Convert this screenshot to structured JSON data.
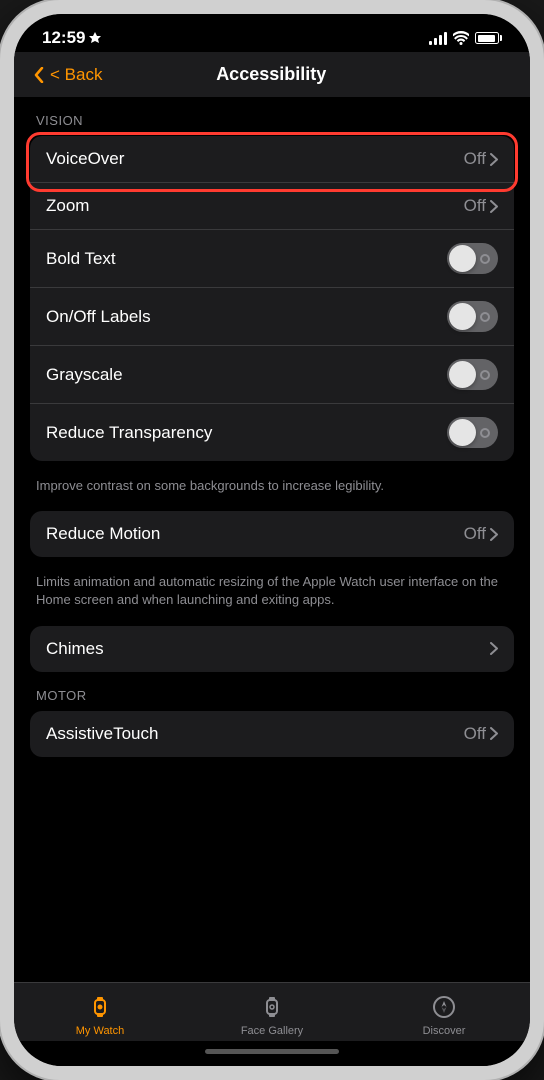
{
  "status": {
    "time": "12:59",
    "location_arrow": "▶",
    "signal_label": "signal",
    "wifi_label": "wifi",
    "battery_label": "battery"
  },
  "nav": {
    "back_label": "< Back",
    "title": "Accessibility"
  },
  "sections": [
    {
      "label": "VISION",
      "rows": [
        {
          "id": "voiceover",
          "label": "VoiceOver",
          "value": "Off",
          "type": "navigate",
          "highlighted": true
        },
        {
          "id": "zoom",
          "label": "Zoom",
          "value": "Off",
          "type": "navigate"
        },
        {
          "id": "bold-text",
          "label": "Bold Text",
          "value": "",
          "type": "toggle"
        },
        {
          "id": "onoff-labels",
          "label": "On/Off Labels",
          "value": "",
          "type": "toggle"
        },
        {
          "id": "grayscale",
          "label": "Grayscale",
          "value": "",
          "type": "toggle"
        },
        {
          "id": "reduce-transparency",
          "label": "Reduce Transparency",
          "value": "",
          "type": "toggle"
        }
      ]
    }
  ],
  "reduce_transparency_description": "Improve contrast on some backgrounds to increase legibility.",
  "reduce_motion": {
    "label": "Reduce Motion",
    "value": "Off",
    "type": "navigate"
  },
  "reduce_motion_description": "Limits animation and automatic resizing of the Apple Watch user interface on the Home screen and when launching and exiting apps.",
  "chimes": {
    "label": "Chimes",
    "type": "navigate"
  },
  "motor_section_label": "MOTOR",
  "assistive_touch": {
    "label": "AssistiveTouch",
    "value": "Off",
    "type": "navigate"
  },
  "tab_bar": {
    "tabs": [
      {
        "id": "my-watch",
        "label": "My Watch",
        "active": true
      },
      {
        "id": "face-gallery",
        "label": "Face Gallery",
        "active": false
      },
      {
        "id": "discover",
        "label": "Discover",
        "active": false
      }
    ]
  }
}
